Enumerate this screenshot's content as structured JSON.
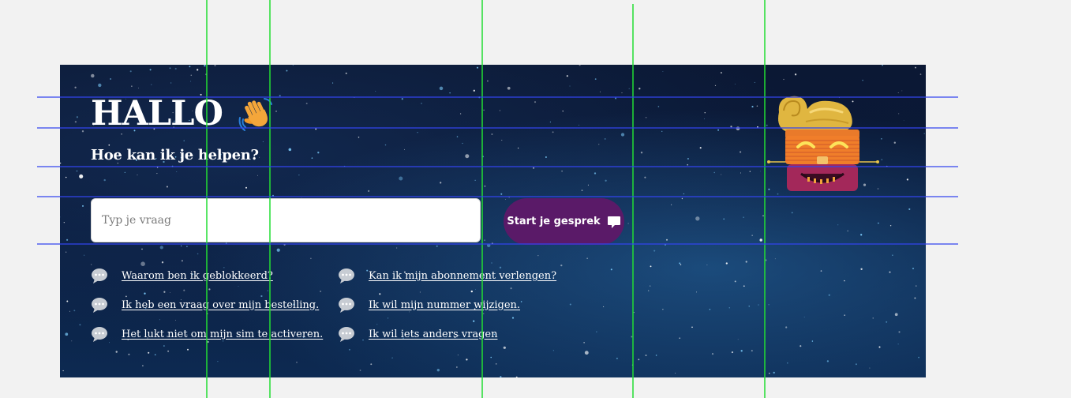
{
  "greeting": {
    "title": "HALLO",
    "wave_emoji": "👋"
  },
  "subtitle": "Hoe kan ik je helpen?",
  "search": {
    "placeholder": "Typ je vraag",
    "value": ""
  },
  "start_button": {
    "label": "Start je gesprek",
    "icon": "chat-bubble-icon"
  },
  "suggestions": {
    "left": [
      "Waarom ben ik geblokkeerd?",
      "Ik heb een vraag over mijn bestelling.",
      "Het lukt niet om mijn sim te activeren."
    ],
    "right": [
      "Kan ik mijn abonnement verlengen?",
      "Ik wil mijn nummer wijzigen.",
      "Ik wil iets anders vragen"
    ],
    "icon": "speech-bubble-icon"
  },
  "colors": {
    "button_bg": "#5a1a68",
    "text": "#ffffff",
    "banner_bg": "#0a1a3a",
    "guide_green": "#22dd33",
    "guide_blue": "#3344ee"
  }
}
